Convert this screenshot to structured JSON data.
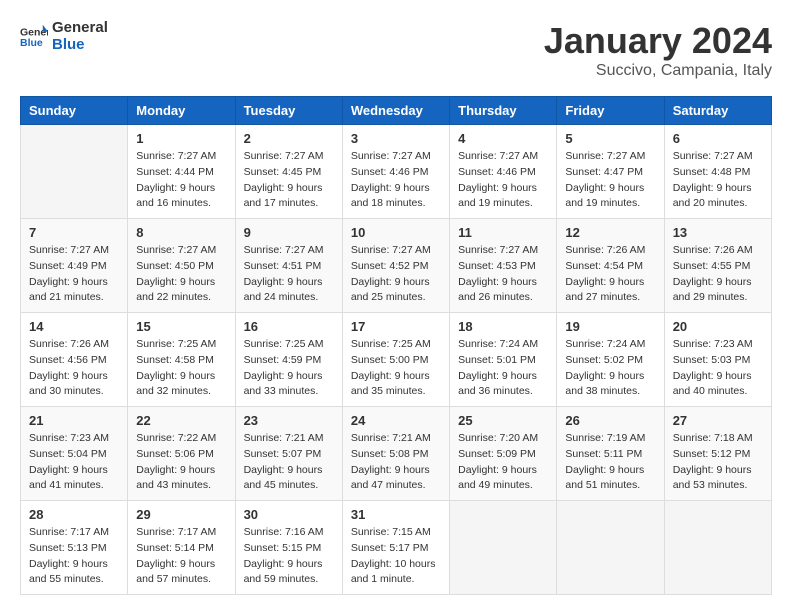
{
  "header": {
    "logo_general": "General",
    "logo_blue": "Blue",
    "title": "January 2024",
    "subtitle": "Succivo, Campania, Italy"
  },
  "weekdays": [
    "Sunday",
    "Monday",
    "Tuesday",
    "Wednesday",
    "Thursday",
    "Friday",
    "Saturday"
  ],
  "weeks": [
    [
      {
        "day": "",
        "info": ""
      },
      {
        "day": "1",
        "info": "Sunrise: 7:27 AM\nSunset: 4:44 PM\nDaylight: 9 hours\nand 16 minutes."
      },
      {
        "day": "2",
        "info": "Sunrise: 7:27 AM\nSunset: 4:45 PM\nDaylight: 9 hours\nand 17 minutes."
      },
      {
        "day": "3",
        "info": "Sunrise: 7:27 AM\nSunset: 4:46 PM\nDaylight: 9 hours\nand 18 minutes."
      },
      {
        "day": "4",
        "info": "Sunrise: 7:27 AM\nSunset: 4:46 PM\nDaylight: 9 hours\nand 19 minutes."
      },
      {
        "day": "5",
        "info": "Sunrise: 7:27 AM\nSunset: 4:47 PM\nDaylight: 9 hours\nand 19 minutes."
      },
      {
        "day": "6",
        "info": "Sunrise: 7:27 AM\nSunset: 4:48 PM\nDaylight: 9 hours\nand 20 minutes."
      }
    ],
    [
      {
        "day": "7",
        "info": "Sunrise: 7:27 AM\nSunset: 4:49 PM\nDaylight: 9 hours\nand 21 minutes."
      },
      {
        "day": "8",
        "info": "Sunrise: 7:27 AM\nSunset: 4:50 PM\nDaylight: 9 hours\nand 22 minutes."
      },
      {
        "day": "9",
        "info": "Sunrise: 7:27 AM\nSunset: 4:51 PM\nDaylight: 9 hours\nand 24 minutes."
      },
      {
        "day": "10",
        "info": "Sunrise: 7:27 AM\nSunset: 4:52 PM\nDaylight: 9 hours\nand 25 minutes."
      },
      {
        "day": "11",
        "info": "Sunrise: 7:27 AM\nSunset: 4:53 PM\nDaylight: 9 hours\nand 26 minutes."
      },
      {
        "day": "12",
        "info": "Sunrise: 7:26 AM\nSunset: 4:54 PM\nDaylight: 9 hours\nand 27 minutes."
      },
      {
        "day": "13",
        "info": "Sunrise: 7:26 AM\nSunset: 4:55 PM\nDaylight: 9 hours\nand 29 minutes."
      }
    ],
    [
      {
        "day": "14",
        "info": "Sunrise: 7:26 AM\nSunset: 4:56 PM\nDaylight: 9 hours\nand 30 minutes."
      },
      {
        "day": "15",
        "info": "Sunrise: 7:25 AM\nSunset: 4:58 PM\nDaylight: 9 hours\nand 32 minutes."
      },
      {
        "day": "16",
        "info": "Sunrise: 7:25 AM\nSunset: 4:59 PM\nDaylight: 9 hours\nand 33 minutes."
      },
      {
        "day": "17",
        "info": "Sunrise: 7:25 AM\nSunset: 5:00 PM\nDaylight: 9 hours\nand 35 minutes."
      },
      {
        "day": "18",
        "info": "Sunrise: 7:24 AM\nSunset: 5:01 PM\nDaylight: 9 hours\nand 36 minutes."
      },
      {
        "day": "19",
        "info": "Sunrise: 7:24 AM\nSunset: 5:02 PM\nDaylight: 9 hours\nand 38 minutes."
      },
      {
        "day": "20",
        "info": "Sunrise: 7:23 AM\nSunset: 5:03 PM\nDaylight: 9 hours\nand 40 minutes."
      }
    ],
    [
      {
        "day": "21",
        "info": "Sunrise: 7:23 AM\nSunset: 5:04 PM\nDaylight: 9 hours\nand 41 minutes."
      },
      {
        "day": "22",
        "info": "Sunrise: 7:22 AM\nSunset: 5:06 PM\nDaylight: 9 hours\nand 43 minutes."
      },
      {
        "day": "23",
        "info": "Sunrise: 7:21 AM\nSunset: 5:07 PM\nDaylight: 9 hours\nand 45 minutes."
      },
      {
        "day": "24",
        "info": "Sunrise: 7:21 AM\nSunset: 5:08 PM\nDaylight: 9 hours\nand 47 minutes."
      },
      {
        "day": "25",
        "info": "Sunrise: 7:20 AM\nSunset: 5:09 PM\nDaylight: 9 hours\nand 49 minutes."
      },
      {
        "day": "26",
        "info": "Sunrise: 7:19 AM\nSunset: 5:11 PM\nDaylight: 9 hours\nand 51 minutes."
      },
      {
        "day": "27",
        "info": "Sunrise: 7:18 AM\nSunset: 5:12 PM\nDaylight: 9 hours\nand 53 minutes."
      }
    ],
    [
      {
        "day": "28",
        "info": "Sunrise: 7:17 AM\nSunset: 5:13 PM\nDaylight: 9 hours\nand 55 minutes."
      },
      {
        "day": "29",
        "info": "Sunrise: 7:17 AM\nSunset: 5:14 PM\nDaylight: 9 hours\nand 57 minutes."
      },
      {
        "day": "30",
        "info": "Sunrise: 7:16 AM\nSunset: 5:15 PM\nDaylight: 9 hours\nand 59 minutes."
      },
      {
        "day": "31",
        "info": "Sunrise: 7:15 AM\nSunset: 5:17 PM\nDaylight: 10 hours\nand 1 minute."
      },
      {
        "day": "",
        "info": ""
      },
      {
        "day": "",
        "info": ""
      },
      {
        "day": "",
        "info": ""
      }
    ]
  ]
}
